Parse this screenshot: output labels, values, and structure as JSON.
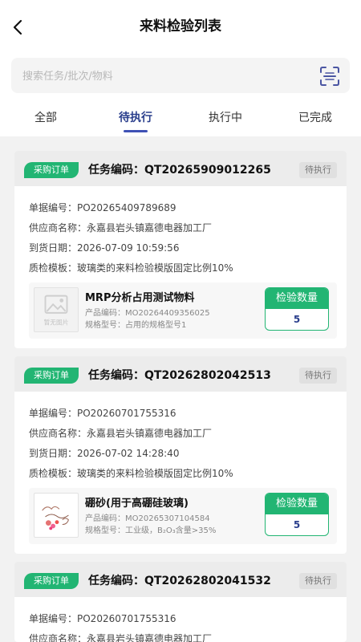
{
  "header": {
    "title": "来料检验列表"
  },
  "search": {
    "placeholder": "搜索任务/批次/物料"
  },
  "tabs": [
    {
      "label": "全部"
    },
    {
      "label": "待执行"
    },
    {
      "label": "执行中"
    },
    {
      "label": "已完成"
    }
  ],
  "active_tab_index": 1,
  "colors": {
    "accent_green": "#22b573",
    "active_tab": "#2a3e8c",
    "tab_underline": "#3f51b5"
  },
  "cards": [
    {
      "badge": "采购订单",
      "task_code": "任务编码：QT20265909012265",
      "status": "待执行",
      "rows": [
        "单据编号：PO20265409789689",
        "供应商名称：永嘉县岩头镇嘉德电器加工厂",
        "到货日期：2026-07-09 10:59:56",
        "质检模板：玻璃类的来料检验模版固定比例10%"
      ],
      "material": {
        "name": "MRP分析占用测试物料",
        "code": "产品编码：MO20264409356025",
        "spec": "规格型号：占用的规格型号1",
        "thumb_text": "暂无图片",
        "qty_label": "检验数量",
        "qty_value": "5"
      }
    },
    {
      "badge": "采购订单",
      "task_code": "任务编码：QT20262802042513",
      "status": "待执行",
      "rows": [
        "单据编号：PO20260701755316",
        "供应商名称：永嘉县岩头镇嘉德电器加工厂",
        "到货日期：2026-07-02 14:28:40",
        "质检模板：玻璃类的来料检验模版固定比例10%"
      ],
      "material": {
        "name": "硼砂(用于高硼硅玻璃)",
        "code": "产品编码：MO20265307104584",
        "spec": "规格型号：工业级，B₂O₃含量>35%",
        "thumb_text": "",
        "qty_label": "检验数量",
        "qty_value": "5"
      }
    },
    {
      "badge": "采购订单",
      "task_code": "任务编码：QT20262802041532",
      "status": "待执行",
      "rows": [
        "单据编号：PO20260701755316",
        "供应商名称：永嘉县岩头镇嘉德电器加工厂"
      ]
    }
  ]
}
